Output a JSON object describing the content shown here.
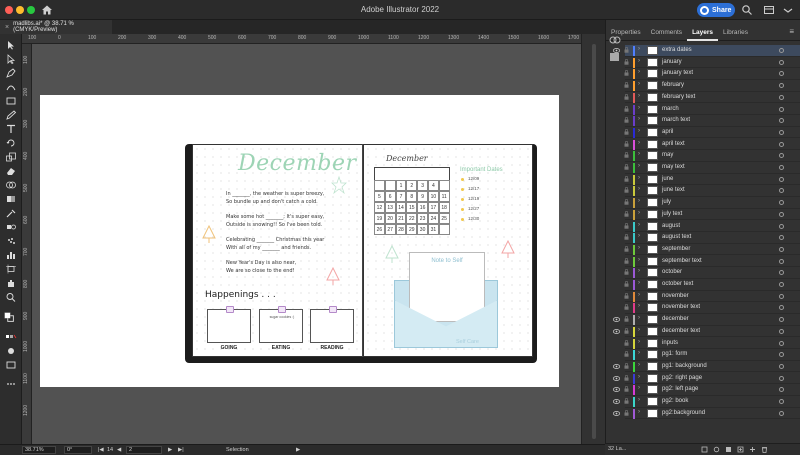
{
  "window": {
    "title": "Adobe Illustrator 2022",
    "share_label": "Share"
  },
  "document_tab": {
    "label": "madlibs.ai* @ 38.71 % (CMYK/Preview)",
    "close": "×"
  },
  "rulers": {
    "top": [
      "100",
      "0",
      "100",
      "200",
      "300",
      "400",
      "500",
      "600",
      "700",
      "800",
      "900",
      "1000",
      "1100",
      "1200",
      "1300",
      "1400",
      "1500",
      "1600",
      "1700"
    ],
    "left": [
      "100",
      "200",
      "300",
      "400",
      "500",
      "600",
      "700",
      "800",
      "900",
      "1000",
      "1100",
      "1200"
    ]
  },
  "planner": {
    "left_page": {
      "title": "December",
      "poem_blocks": [
        "In _______, the weather is super breezy,\nSo bundle up and don't catch a cold.",
        "Make some hot _______; It's super easy,\nOutside is snowing!! So I've been told.",
        "Celebrating _______ Christmas this year\nWith all of my _______ and friends.",
        "New Year's Day is also near,\nWe are so close to the end!"
      ],
      "happenings_title": "Happenings . . .",
      "boxes": [
        {
          "label": "GOING",
          "note": ""
        },
        {
          "label": "EATING",
          "note": "sugar cookies :)"
        },
        {
          "label": "READING",
          "note": ""
        }
      ]
    },
    "right_page": {
      "calendar_title": "December",
      "calendar_rows": [
        [
          "",
          "",
          "1",
          "2",
          "3",
          "4"
        ],
        [
          "5",
          "6",
          "7",
          "8",
          "9",
          "10",
          "11"
        ],
        [
          "12",
          "13",
          "14",
          "15",
          "16",
          "17",
          "18"
        ],
        [
          "19",
          "20",
          "21",
          "22",
          "23",
          "24",
          "25"
        ],
        [
          "26",
          "27",
          "28",
          "29",
          "30",
          "31",
          ""
        ]
      ],
      "important_title": "Important Dates",
      "important_dates": [
        "12/09",
        "12/17",
        "12/19",
        "12/27",
        "12/30"
      ],
      "envelope_card_title": "Note to Self",
      "envelope_footer": "Self Care"
    }
  },
  "status": {
    "zoom": "38.71%",
    "rotation": "0°",
    "artboard_prev": "14",
    "artboard_num": "2",
    "tool": "Selection"
  },
  "panel": {
    "tabs": [
      "Properties",
      "Comments",
      "Layers",
      "Libraries"
    ],
    "active_tab": "Layers",
    "layer_count": "32 La...",
    "layers": [
      {
        "name": "extra dates",
        "color": "#4f7fff",
        "eye": true,
        "selected": true
      },
      {
        "name": "january",
        "color": "#ff9f2e",
        "eye": false
      },
      {
        "name": "january text",
        "color": "#ff9f2e",
        "eye": false
      },
      {
        "name": "february",
        "color": "#ff9f2e",
        "eye": false
      },
      {
        "name": "february text",
        "color": "#e15a5a",
        "eye": false
      },
      {
        "name": "march",
        "color": "#6a3ec9",
        "eye": false
      },
      {
        "name": "march text",
        "color": "#6a3ec9",
        "eye": false
      },
      {
        "name": "april",
        "color": "#2a2ad6",
        "eye": false
      },
      {
        "name": "april text",
        "color": "#d94fd9",
        "eye": false
      },
      {
        "name": "may",
        "color": "#3bbf3b",
        "eye": false
      },
      {
        "name": "may text",
        "color": "#3bbf3b",
        "eye": false
      },
      {
        "name": "june",
        "color": "#c9c93b",
        "eye": false
      },
      {
        "name": "june text",
        "color": "#c9c93b",
        "eye": false
      },
      {
        "name": "july",
        "color": "#c9a03b",
        "eye": false
      },
      {
        "name": "july text",
        "color": "#c9a03b",
        "eye": false
      },
      {
        "name": "august",
        "color": "#3bc9c9",
        "eye": false
      },
      {
        "name": "august text",
        "color": "#3bc9c9",
        "eye": false
      },
      {
        "name": "september",
        "color": "#6ec93b",
        "eye": false
      },
      {
        "name": "september text",
        "color": "#6ec93b",
        "eye": false
      },
      {
        "name": "october",
        "color": "#9b59d6",
        "eye": false
      },
      {
        "name": "october text",
        "color": "#9b59d6",
        "eye": false
      },
      {
        "name": "november",
        "color": "#e08a3b",
        "eye": false
      },
      {
        "name": "november text",
        "color": "#e03b8a",
        "eye": false
      },
      {
        "name": "december",
        "color": "#b0b0b0",
        "eye": true
      },
      {
        "name": "december text",
        "color": "#d6d63b",
        "eye": true
      },
      {
        "name": "inputs",
        "color": "#d6d63b",
        "eye": false
      },
      {
        "name": "pg1: form",
        "color": "#3bd6d6",
        "eye": false
      },
      {
        "name": "pg1: background",
        "color": "#3bd63b",
        "eye": true
      },
      {
        "name": "pg2: right page",
        "color": "#3b3bd6",
        "eye": true
      },
      {
        "name": "pg2: left page",
        "color": "#d63bd6",
        "eye": true
      },
      {
        "name": "pg2: book",
        "color": "#3bd6c9",
        "eye": true
      },
      {
        "name": "pg2:background",
        "color": "#a05ad6",
        "eye": true
      }
    ]
  }
}
